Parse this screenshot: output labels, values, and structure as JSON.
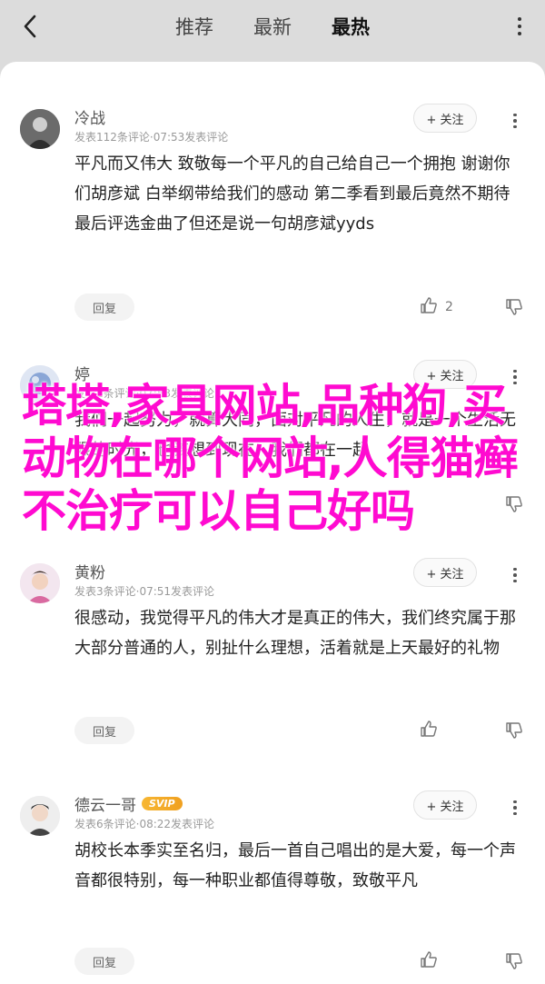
{
  "header": {
    "tabs": [
      "推荐",
      "最新",
      "最热"
    ],
    "active_tab": 2
  },
  "comments": [
    {
      "username": "冷战",
      "meta": "发表112条评论·07:53发表评论",
      "follow_label": "+ 关注",
      "text": "平凡而又伟大  致敬每一个平凡的自己给自己一个拥抱 谢谢你们胡彦斌 白举纲带给我们的感动 第二季看到最后竟然不期待最后评选金曲了但还是说一句胡彦斌yyds",
      "reply_label": "回复",
      "likes": "2"
    },
    {
      "username": "婷",
      "meta": "发表1条评论·07:53发表评论",
      "follow_label": "+ 关注",
      "text": "我们一起努力，就算大同，面对平凡的人生，就是一个生活无限的时光，也该想到现在，我们都在一起",
      "reply_label": "回复",
      "likes": ""
    },
    {
      "username": "黄粉",
      "meta": "发表3条评论·07:51发表评论",
      "follow_label": "+ 关注",
      "text": "很感动，我觉得平凡的伟大才是真正的伟大，我们终究属于那大部分普通的人，别扯什么理想，活着就是上天最好的礼物",
      "reply_label": "回复",
      "likes": ""
    },
    {
      "username": "德云一哥",
      "badge": "SVIP",
      "meta": "发表6条评论·08:22发表评论",
      "follow_label": "+ 关注",
      "text": "胡校长本季实至名归，最后一首自己唱出的是大爱，每一个声音都很特别，每一种职业都值得尊敬，致敬平凡",
      "reply_label": "回复",
      "likes": ""
    }
  ],
  "overlay_text": "塔塔,家具网站,品种狗,买动物在哪个网站,人得猫癣不治疗可以自己好吗",
  "colors": {
    "overlay": "#ff0ad0",
    "background": "#dcdcdc"
  }
}
